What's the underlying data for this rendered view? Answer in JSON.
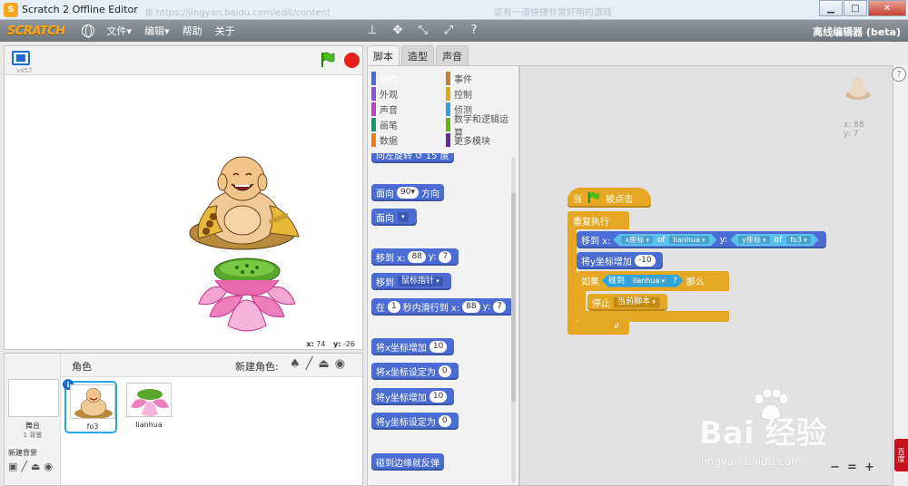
{
  "window": {
    "title": "Scratch 2 Offline Editor",
    "ghost_text": "⊞  https://jingyan.baidu.com/edit/content",
    "ghost_text_right": "这有一道快捷非常好用的游戏",
    "controls": {
      "minimize": "▁",
      "maximize": "□",
      "close": "✕"
    }
  },
  "menubar": {
    "logo": "SCRATCH",
    "items": [
      {
        "label": "文件▾"
      },
      {
        "label": "编辑▾"
      },
      {
        "label": "帮助"
      },
      {
        "label": "关于"
      }
    ],
    "toolbar_icons": [
      "⊥",
      "✥",
      "⤡",
      "⤢",
      "?"
    ],
    "editor_label": "离线编辑器 (beta)"
  },
  "stage": {
    "version": "v457",
    "mouse_x_label": "x:",
    "mouse_x": "74",
    "mouse_y_label": "y:",
    "mouse_y": "-26"
  },
  "sprites": {
    "header_label": "角色",
    "new_sprite_label": "新建角色:",
    "new_sprite_tools": [
      "♠",
      "╱",
      "⏏",
      "◉"
    ],
    "stage_name": "舞台",
    "stage_backdrops": "1 背景",
    "new_backdrop_label": "新建背景",
    "backdrop_tools": [
      "▣",
      "╱",
      "⏏",
      "◉"
    ],
    "list": [
      {
        "name": "fo3",
        "selected": true
      },
      {
        "name": "lianhua",
        "selected": false
      }
    ]
  },
  "tabs": [
    {
      "label": "脚本",
      "active": true
    },
    {
      "label": "造型",
      "active": false
    },
    {
      "label": "声音",
      "active": false
    }
  ],
  "categories": [
    {
      "label": "动作",
      "color": "#4a6cd4",
      "active": true
    },
    {
      "label": "事件",
      "color": "#c88330",
      "active": false
    },
    {
      "label": "外观",
      "color": "#8a55d7",
      "active": false
    },
    {
      "label": "控制",
      "color": "#e1a91a",
      "active": false
    },
    {
      "label": "声音",
      "color": "#bb42c3",
      "active": false
    },
    {
      "label": "侦测",
      "color": "#2ca5e2",
      "active": false
    },
    {
      "label": "画笔",
      "color": "#0e9a6c",
      "active": false
    },
    {
      "label": "数字和逻辑运算",
      "color": "#5cb712",
      "active": false
    },
    {
      "label": "数据",
      "color": "#ee7d16",
      "active": false
    },
    {
      "label": "更多模块",
      "color": "#632d99",
      "active": false
    }
  ],
  "palette_blocks": {
    "turn_partial": "向左旋转 ↺ 15 度",
    "point_dir": {
      "label": "面向",
      "value": "90▾",
      "suffix": "方向"
    },
    "point_towards": {
      "label": "面向",
      "value": ""
    },
    "goto_xy": {
      "label": "移到 x:",
      "x": "88",
      "y_label": "y:",
      "y": "7"
    },
    "goto_target": {
      "label": "移到",
      "value": "鼠标指针"
    },
    "glide": {
      "label": "在",
      "secs": "1",
      "mid": "秒内滑行到 x:",
      "x": "88",
      "y_label": "y:",
      "y": "7"
    },
    "change_x": {
      "label": "将x坐标增加",
      "value": "10"
    },
    "set_x": {
      "label": "将x坐标设定为",
      "value": "0"
    },
    "change_y": {
      "label": "将y坐标增加",
      "value": "10"
    },
    "set_y": {
      "label": "将y坐标设定为",
      "value": "0"
    },
    "bounce": "碰到边缘就反弹"
  },
  "script": {
    "hat": {
      "prefix": "当",
      "suffix": "被点击"
    },
    "forever": "重复执行",
    "goto": {
      "label": "移到 x:",
      "x_attr": "x座标",
      "x_of": "of",
      "x_sprite": "lianhua",
      "y_label": "y:",
      "y_attr": "y座标",
      "y_of": "of",
      "y_sprite": "fo3"
    },
    "change_y": {
      "label": "将y坐标增加",
      "value": "-10"
    },
    "if": {
      "prefix": "如果",
      "cond_label": "碰到",
      "cond_value": "lianhua",
      "cond_q": "?",
      "suffix": "那么"
    },
    "stop": {
      "label": "停止",
      "value": "当前脚本"
    },
    "sprite_x": "x: 88",
    "sprite_y": "y: 7",
    "help": "?",
    "zoom": [
      "−",
      "=",
      "+"
    ]
  },
  "watermark": {
    "brand": "Bai  经验",
    "url": "jingyan.baidu.com"
  },
  "side_badge": "百度"
}
